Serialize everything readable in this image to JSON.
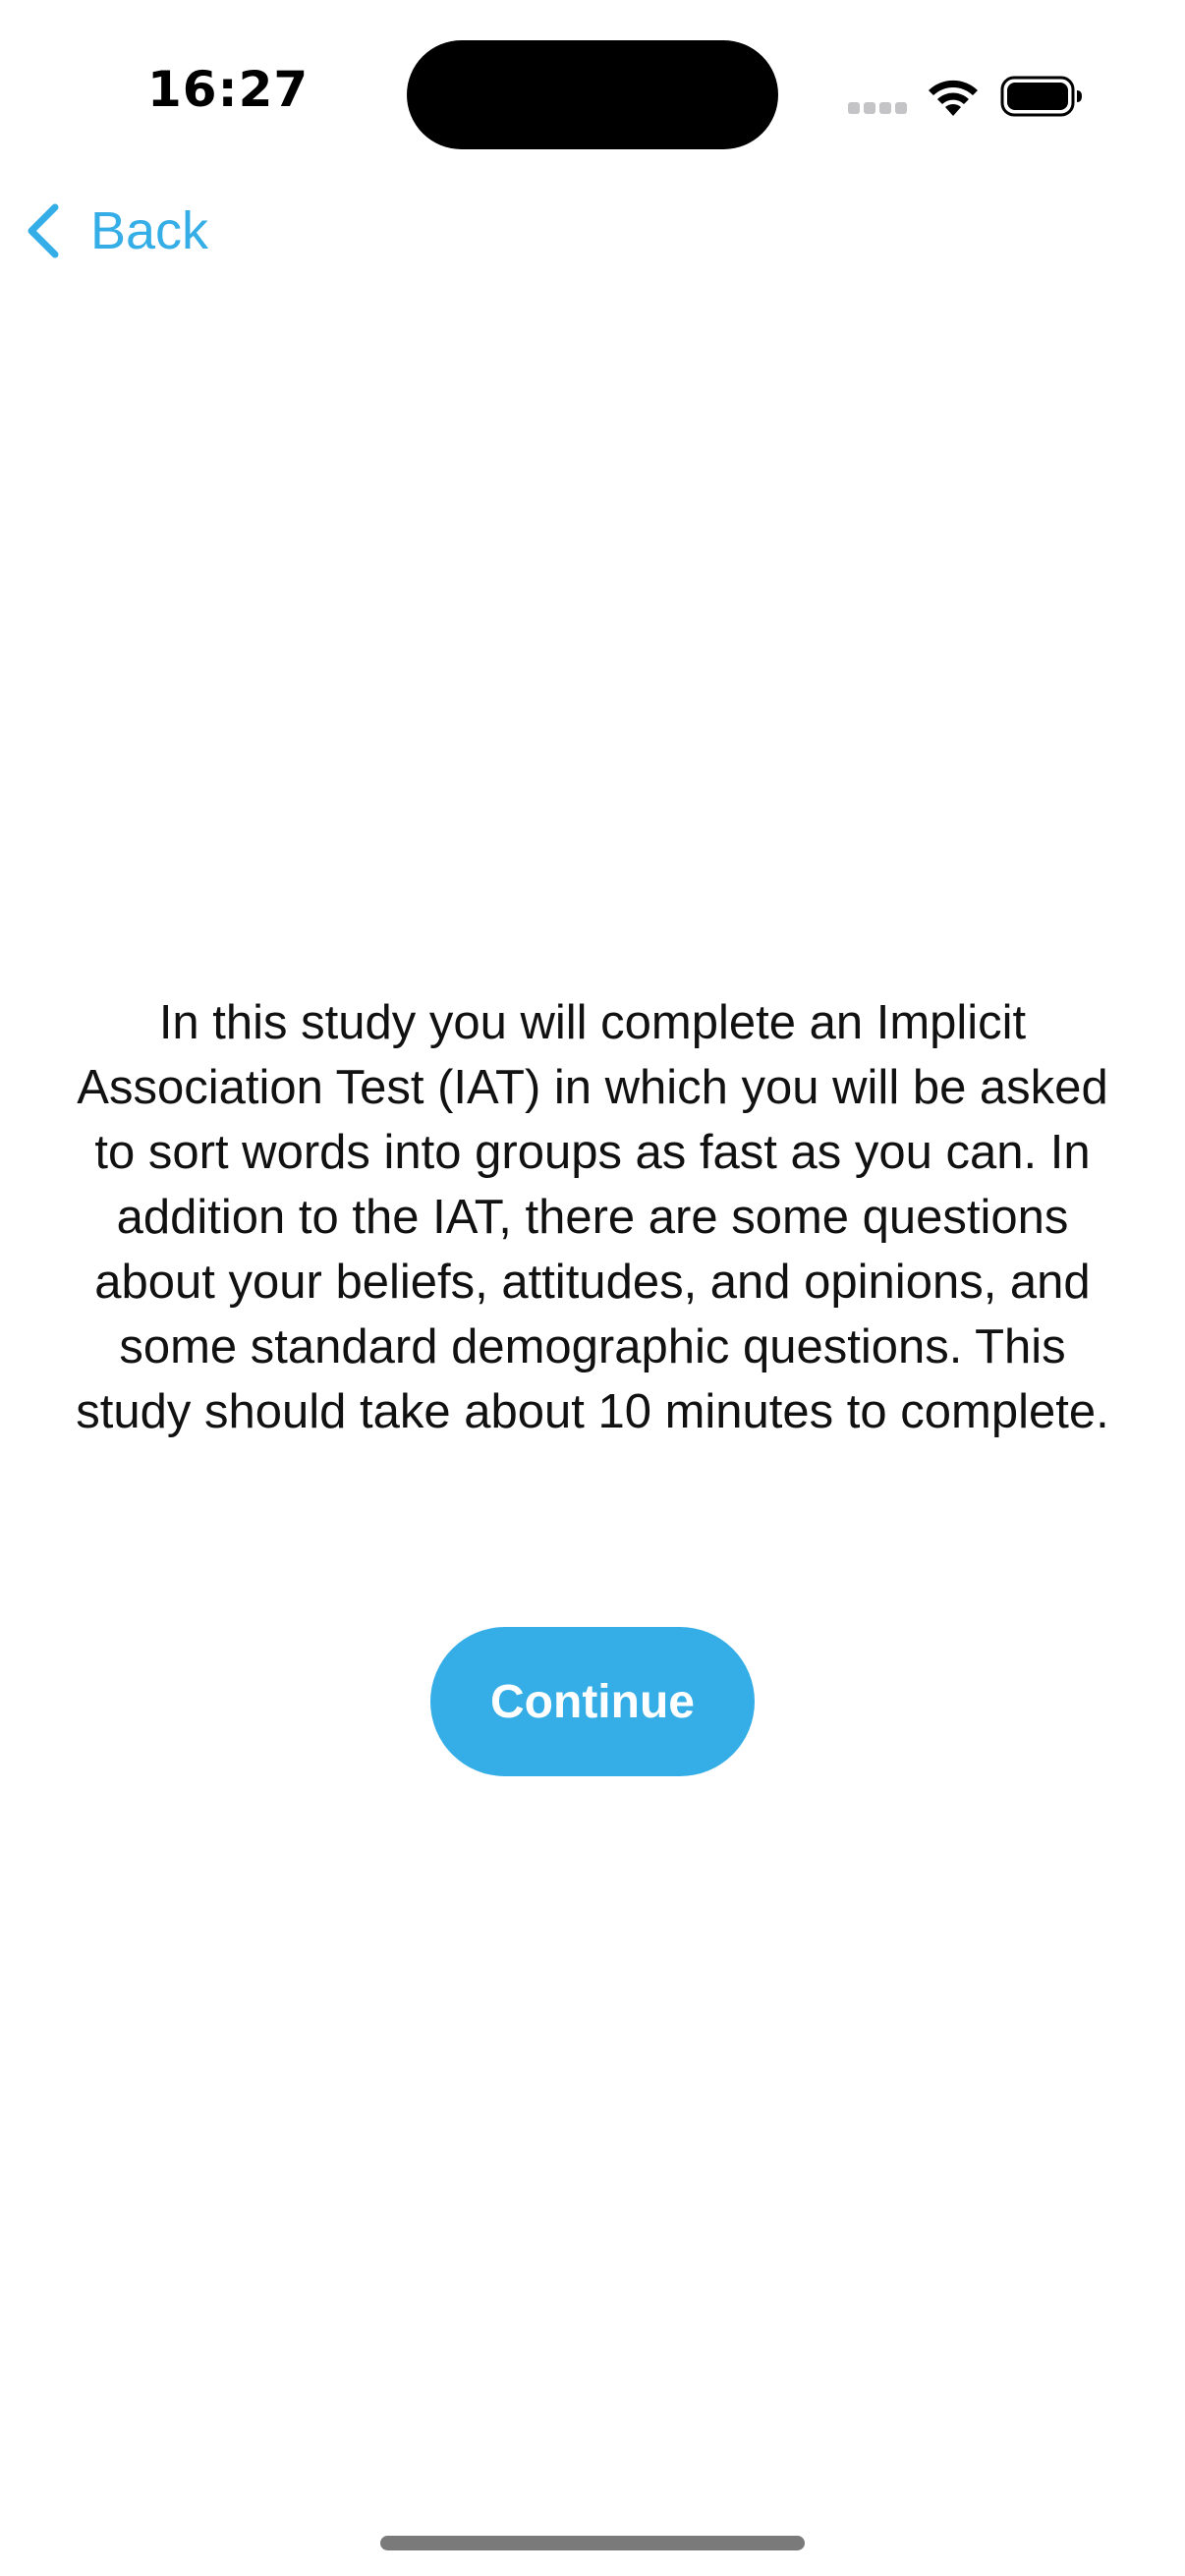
{
  "status_bar": {
    "time": "16:27",
    "icons": [
      "cellular-signal-icon",
      "wifi-icon",
      "battery-icon"
    ]
  },
  "nav": {
    "back_label": "Back",
    "back_icon": "chevron-left-icon"
  },
  "content": {
    "intro_text": "In this study you will complete an Implicit Association Test (IAT) in which you will be asked to sort words into groups as fast as you can. In addition to the IAT, there are some questions about your beliefs, attitudes, and opinions, and some standard demographic questions. This study should take about 10 minutes to complete.",
    "continue_label": "Continue"
  },
  "colors": {
    "accent": "#35ade6",
    "background": "#ffffff",
    "text": "#111111"
  }
}
